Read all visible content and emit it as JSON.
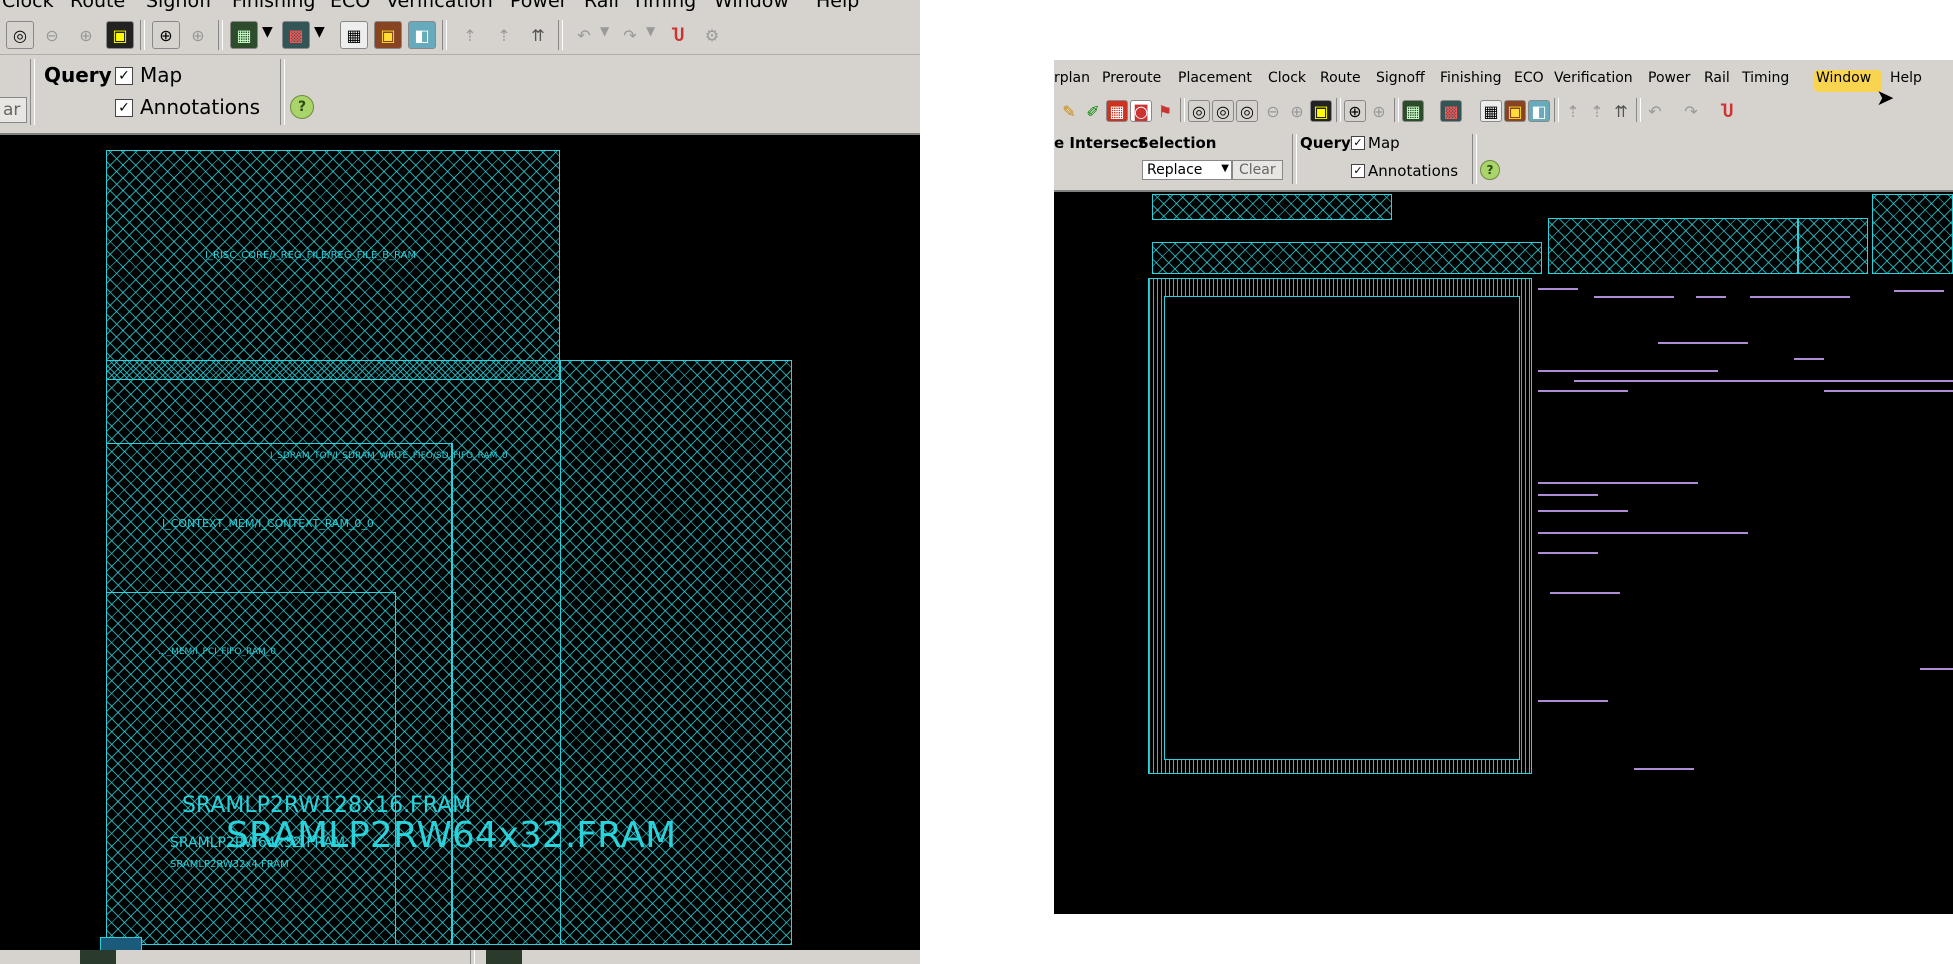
{
  "left_window": {
    "menu": [
      "Clock",
      "Route",
      "Signoff",
      "Finishing",
      "ECO",
      "Verification",
      "Power",
      "Rail",
      "Timing",
      "Window",
      "Help"
    ],
    "toolbar_icons": [
      "zoom-fit-icon",
      "zoom-out-icon",
      "zoom-in-icon",
      "select-icon",
      "zoom-area-icon",
      "zoom-prev-icon",
      "layer-icon",
      "color-icon",
      "grid-icon",
      "highlight-icon",
      "view-icon",
      "move-up-icon",
      "move-top-icon",
      "undo-icon",
      "redo-icon",
      "magnet-icon",
      "settings-icon"
    ],
    "query_label": "Query",
    "map_label": "Map",
    "annotations_label": "Annotations",
    "clear_label": "ar",
    "macros": {
      "reg_file": "I_RISC_CORE/I_REG_FILE/REG_FILE_B_RAM",
      "sdram": "I_SDRAM_TOP/I_SDRAM_WRITE_FIFO/SD_FIFO_RAM_0",
      "context": "I_CONTEXT_MEM/I_CONTEXT_RAM_0_0",
      "pci": "..._MEM/I_PCI_FIFO_RAM_0",
      "big_label_1": "SRAMLP2RW128x16.FRAM",
      "big_label_2": "SRAMLP2RW64x32.FRAM",
      "small_label_1": "SRAMLP2RW64x32.FRAM",
      "small_label_2": "SRAMLP2RW32x4.FRAM"
    }
  },
  "right_window": {
    "menu": [
      "rplan",
      "Preroute",
      "Placement",
      "Clock",
      "Route",
      "Signoff",
      "Finishing",
      "ECO",
      "Verification",
      "Power",
      "Rail",
      "Timing",
      "Window",
      "Help"
    ],
    "intersect_label": "e Intersect",
    "selection_label": "Selection",
    "selection_value": "Replace",
    "clear_label": "Clear",
    "query_label": "Query",
    "map_label": "Map",
    "annotations_label": "Annotations"
  },
  "colors": {
    "macro_cyan": "#29d3dc",
    "net_purple": "#b08cd8",
    "canvas_bg": "#000000",
    "highlight": "#ffd43b"
  }
}
